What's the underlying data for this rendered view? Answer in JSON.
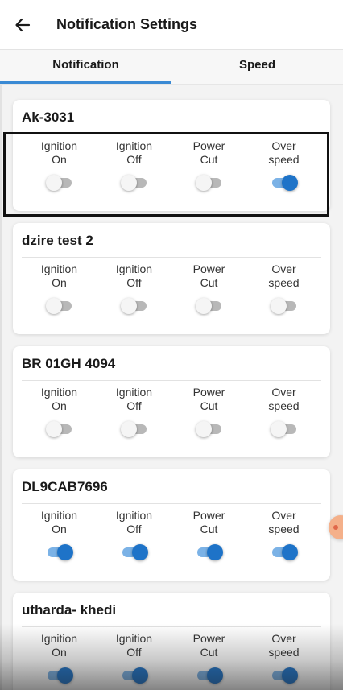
{
  "header": {
    "title": "Notification Settings",
    "back_icon": "arrow-left-icon"
  },
  "tabs": [
    {
      "label": "Notification",
      "active": true
    },
    {
      "label": "Speed",
      "active": false
    }
  ],
  "option_labels": [
    "Ignition\nOn",
    "Ignition\nOff",
    "Power\nCut",
    "Over\nspeed"
  ],
  "colors": {
    "accent": "#1e73c8",
    "track_on": "#7bb2e6",
    "track_off": "#b8b8b8",
    "tab_indicator": "#3a8ad4"
  },
  "vehicles": [
    {
      "name": "Ak-3031",
      "toggles": [
        false,
        false,
        false,
        true
      ]
    },
    {
      "name": "dzire test 2",
      "toggles": [
        false,
        false,
        false,
        false
      ]
    },
    {
      "name": "BR 01GH 4094",
      "toggles": [
        false,
        false,
        false,
        false
      ]
    },
    {
      "name": "DL9CAB7696",
      "toggles": [
        true,
        true,
        true,
        true
      ]
    },
    {
      "name": "utharda- khedi",
      "toggles": [
        true,
        true,
        true,
        true
      ]
    }
  ]
}
